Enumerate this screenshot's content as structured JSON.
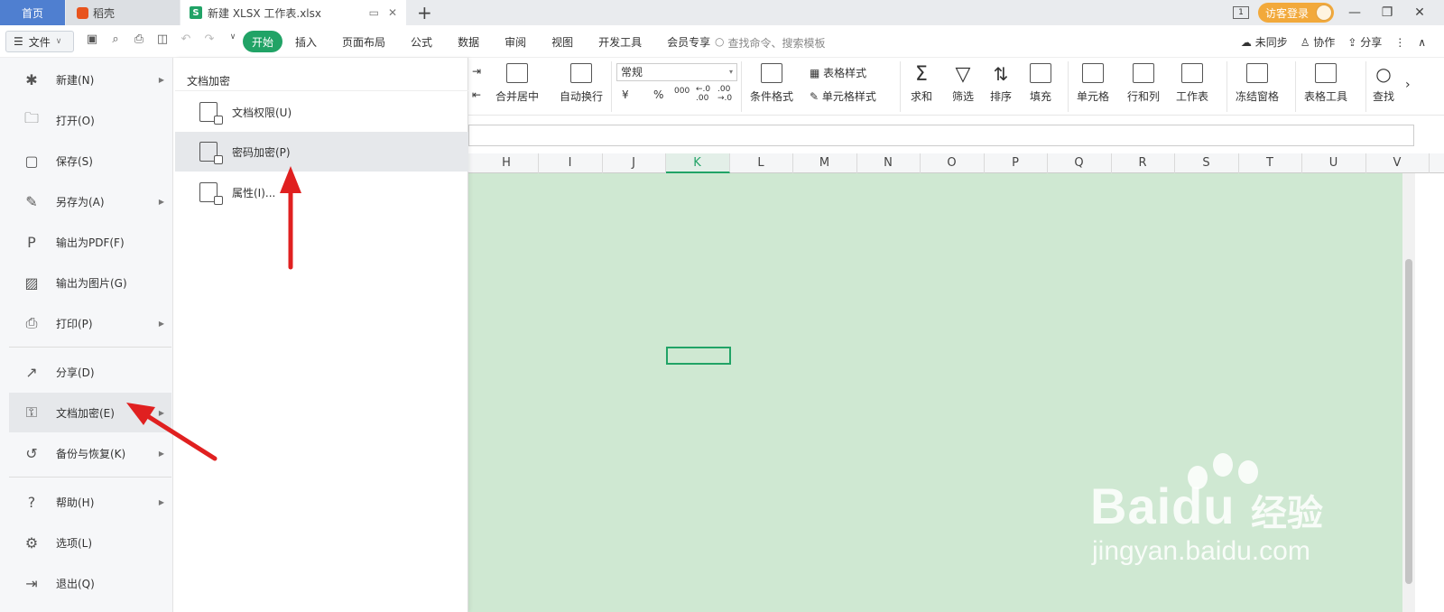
{
  "tabs": {
    "home": "首页",
    "daoke": "稻壳",
    "doc": "新建 XLSX 工作表.xlsx",
    "doc_badge": "S"
  },
  "top_right": {
    "page_indicator": "1",
    "login": "访客登录"
  },
  "menu": {
    "file": "文件",
    "tabs": [
      "开始",
      "插入",
      "页面布局",
      "公式",
      "数据",
      "审阅",
      "视图",
      "开发工具",
      "会员专享"
    ],
    "search_placeholder": "查找命令、搜索模板",
    "sync": "未同步",
    "collab": "协作",
    "share": "分享"
  },
  "toolbar": {
    "merge": "合并居中",
    "wrap": "自动换行",
    "number_format": "常规",
    "currency": "¥",
    "percent": "%",
    "thousands": "000",
    "dec_inc": "←.0 .00",
    "dec_dec": ".00 →.0",
    "cond_format": "条件格式",
    "table_style": "表格样式",
    "cell_style": "单元格样式",
    "sum": "求和",
    "filter": "筛选",
    "sort": "排序",
    "fill": "填充",
    "cell": "单元格",
    "rowcol": "行和列",
    "sheet": "工作表",
    "freeze": "冻结窗格",
    "table_tools": "表格工具",
    "find": "查找"
  },
  "columns": [
    "H",
    "I",
    "J",
    "K",
    "L",
    "M",
    "N",
    "O",
    "P",
    "Q",
    "R",
    "S",
    "T",
    "U",
    "V"
  ],
  "selected_column": "K",
  "file_menu": [
    {
      "label": "新建(N)",
      "icon": "new-doc-icon",
      "arrow": true
    },
    {
      "label": "打开(O)",
      "icon": "folder-open-icon",
      "arrow": false
    },
    {
      "label": "保存(S)",
      "icon": "save-icon",
      "arrow": false
    },
    {
      "label": "另存为(A)",
      "icon": "save-as-icon",
      "arrow": true
    },
    {
      "label": "输出为PDF(F)",
      "icon": "pdf-export-icon",
      "arrow": false
    },
    {
      "label": "输出为图片(G)",
      "icon": "image-export-icon",
      "arrow": false
    },
    {
      "label": "打印(P)",
      "icon": "printer-icon",
      "arrow": true
    },
    {
      "label": "分享(D)",
      "icon": "share-icon",
      "arrow": false
    },
    {
      "label": "文档加密(E)",
      "icon": "doc-encrypt-icon",
      "arrow": true
    },
    {
      "label": "备份与恢复(K)",
      "icon": "backup-icon",
      "arrow": true
    },
    {
      "label": "帮助(H)",
      "icon": "help-icon",
      "arrow": true
    },
    {
      "label": "选项(L)",
      "icon": "gear-icon",
      "arrow": false
    },
    {
      "label": "退出(Q)",
      "icon": "exit-icon",
      "arrow": false
    }
  ],
  "submenu": {
    "title": "文档加密",
    "items": [
      {
        "label": "文档权限(U)",
        "icon": "doc-permission-icon"
      },
      {
        "label": "密码加密(P)",
        "icon": "password-lock-icon"
      },
      {
        "label": "属性(I)...",
        "icon": "doc-properties-icon"
      }
    ]
  },
  "watermark": {
    "logo": "Baidu",
    "cn": "经验",
    "url": "jingyan.baidu.com"
  },
  "colors": {
    "accent": "#21a366",
    "sheet_bg": "#cfe8d2",
    "arrow": "#e02020",
    "home_tab": "#4f7fd0",
    "login_pill": "#f2a93b"
  }
}
